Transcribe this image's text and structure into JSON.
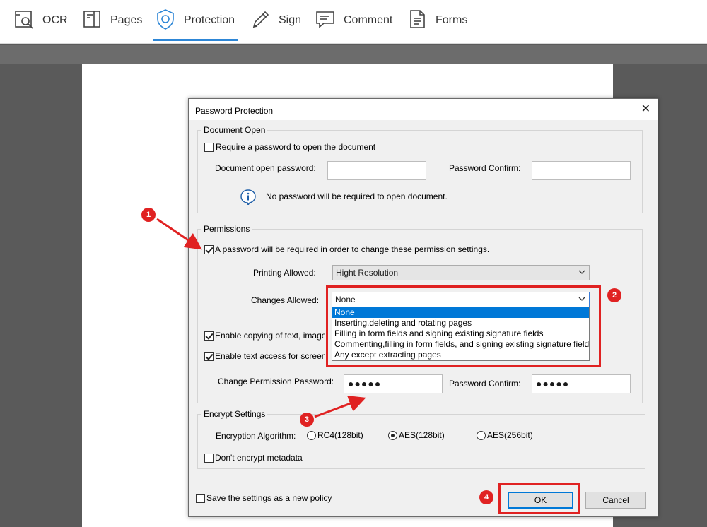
{
  "toolbar": {
    "items": [
      {
        "label": "OCR",
        "icon": "ocr-icon"
      },
      {
        "label": "Pages",
        "icon": "pages-icon"
      },
      {
        "label": "Protection",
        "icon": "shield-icon",
        "active": true
      },
      {
        "label": "Sign",
        "icon": "pen-icon"
      },
      {
        "label": "Comment",
        "icon": "comment-icon"
      },
      {
        "label": "Forms",
        "icon": "forms-icon"
      }
    ],
    "accent": "#2d86d6"
  },
  "dialog": {
    "title": "Password Protection",
    "close": "✕",
    "document_open": {
      "group_label": "Document Open",
      "require_password_label": "Require a password to open the document",
      "require_password_checked": false,
      "open_password_label": "Document open password:",
      "open_password_value": "",
      "confirm_label": "Password Confirm:",
      "confirm_value": "",
      "info_text": "No password will be required to open document."
    },
    "permissions": {
      "group_label": "Permissions",
      "require_permission_label": "A password will be required in order to change these permission settings.",
      "require_permission_checked": true,
      "printing_label": "Printing Allowed:",
      "printing_value": "Hight Resolution",
      "changes_label": "Changes Allowed:",
      "changes_value": "None",
      "changes_options": [
        "None",
        "Inserting,deleting and rotating pages",
        "Filling in form fields and signing existing signature fields",
        "Commenting,filling in form fields, and signing existing signature fields",
        "Any except extracting pages"
      ],
      "copy_label": "Enable copying of text, images, and other content",
      "copy_checked": true,
      "text_access_label": "Enable text access for screen reader devices for the visually impaired",
      "text_access_checked": true,
      "change_password_label": "Change Permission Password:",
      "change_password_value": "●●●●●",
      "confirm_label": "Password Confirm:",
      "confirm_value": "●●●●●"
    },
    "encrypt": {
      "group_label": "Encrypt Settings",
      "algorithm_label": "Encryption Algorithm:",
      "options": [
        "RC4(128bit)",
        "AES(128bit)",
        "AES(256bit)"
      ],
      "selected": "AES(128bit)",
      "metadata_label": "Don't encrypt metadata",
      "metadata_checked": false
    },
    "save_policy_label": "Save the settings as a new policy",
    "save_policy_checked": false,
    "ok_label": "OK",
    "cancel_label": "Cancel"
  },
  "annotations": {
    "color": "#e02222",
    "badges": [
      "1",
      "2",
      "3",
      "4"
    ]
  }
}
